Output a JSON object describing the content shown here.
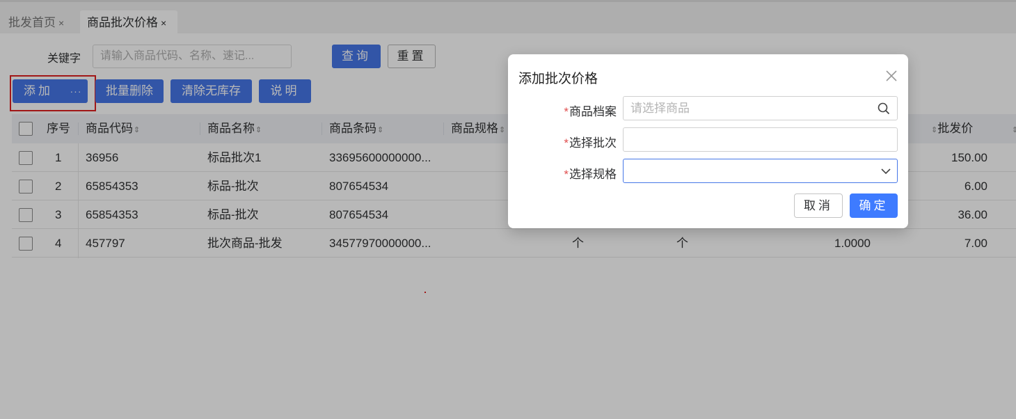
{
  "tabs": [
    {
      "label": "批发首页",
      "close": "×"
    },
    {
      "label": "商品批次价格",
      "close": "×"
    }
  ],
  "search": {
    "label": "关键字",
    "placeholder": "请输入商品代码、名称、速记..."
  },
  "buttons": {
    "query": "查询",
    "reset": "重置",
    "add": "添加",
    "more": "···",
    "bulk_delete": "批量删除",
    "clear_no_stock": "清除无库存",
    "explain": "说明"
  },
  "table": {
    "headers": {
      "index": "序号",
      "code": "商品代码",
      "name": "商品名称",
      "barcode": "商品条码",
      "spec": "商品规格",
      "wholesale_price": "批发价"
    },
    "sort_icon": "⇕",
    "rows": [
      {
        "index": "1",
        "code": "36956",
        "name": "标品批次1",
        "barcode": "33695600000000...",
        "unit1": "",
        "unit2": "",
        "ratio": "",
        "price": "150.00"
      },
      {
        "index": "2",
        "code": "65854353",
        "name": "标品-批次",
        "barcode": "807654534",
        "unit1": "",
        "unit2": "",
        "ratio": "",
        "price": "6.00"
      },
      {
        "index": "3",
        "code": "65854353",
        "name": "标品-批次",
        "barcode": "807654534",
        "unit1": "",
        "unit2": "",
        "ratio": "",
        "price": "36.00"
      },
      {
        "index": "4",
        "code": "457797",
        "name": "批次商品-批发",
        "barcode": "34577970000000...",
        "unit1": "个",
        "unit2": "个",
        "ratio": "1.0000",
        "price": "7.00"
      }
    ]
  },
  "modal": {
    "title": "添加批次价格",
    "required_mark": "*",
    "fields": {
      "product": {
        "label": "商品档案",
        "placeholder": "请选择商品",
        "value": ""
      },
      "batch": {
        "label": "选择批次",
        "value": ""
      },
      "spec": {
        "label": "选择规格",
        "value": ""
      }
    },
    "cancel": "取消",
    "confirm": "确定"
  },
  "colors": {
    "primary": "#4677e8",
    "confirm": "#3e7bff",
    "required": "#e05050",
    "highlight": "#e02020"
  },
  "icons": {
    "close": "close-icon",
    "search": "search-icon",
    "dropdown": "chevron-down-icon"
  }
}
